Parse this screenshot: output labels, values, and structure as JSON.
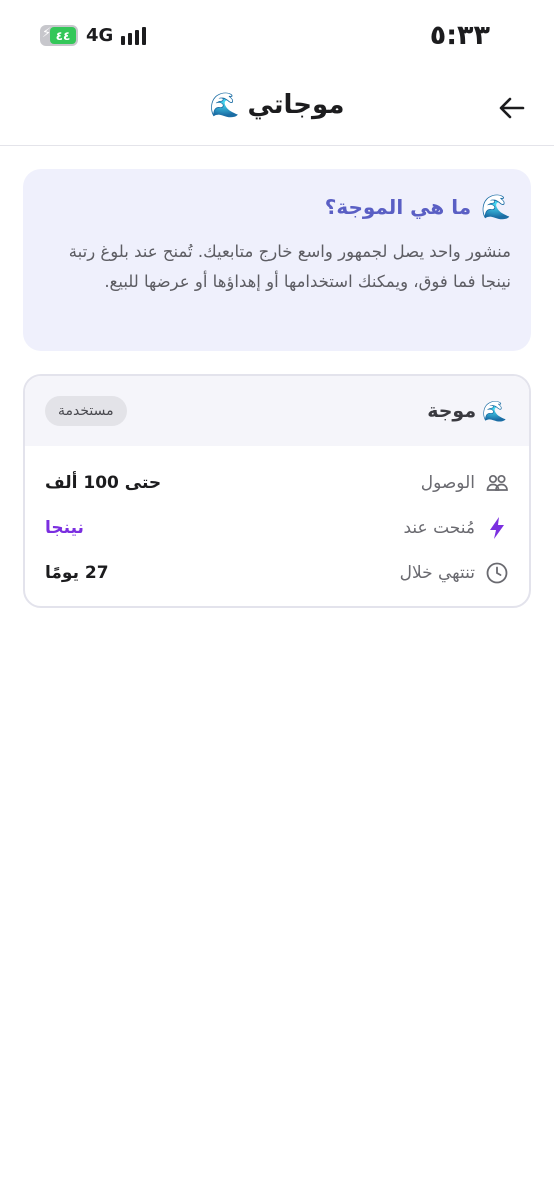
{
  "status_bar": {
    "time": "٥:٣٣",
    "battery": "٤٤",
    "network": "4G"
  },
  "header": {
    "title": "موجاتي",
    "emoji": "🌊"
  },
  "info": {
    "emoji": "🌊",
    "title": "ما هي الموجة؟",
    "body": "منشور واحد يصل لجمهور واسع خارج متابعيك. تُمنح عند بلوغ رتبة نينجا فما فوق، ويمكنك استخدامها أو إهداؤها أو عرضها للبيع."
  },
  "wave_card": {
    "emoji": "🌊",
    "title": "موجة",
    "badge": "مستخدمة",
    "rows": [
      {
        "icon": "users-icon",
        "label": "الوصول",
        "value": "حتى 100 ألف"
      },
      {
        "icon": "bolt-icon",
        "label": "مُنحت عند",
        "value": "نينجا"
      },
      {
        "icon": "clock-icon",
        "label": "تنتهي خلال",
        "value": "27 يومًا"
      }
    ]
  },
  "colors": {
    "accent": "#5a5fc4",
    "rank": "#7b2fe0",
    "info_bg": "#eff0fc"
  }
}
